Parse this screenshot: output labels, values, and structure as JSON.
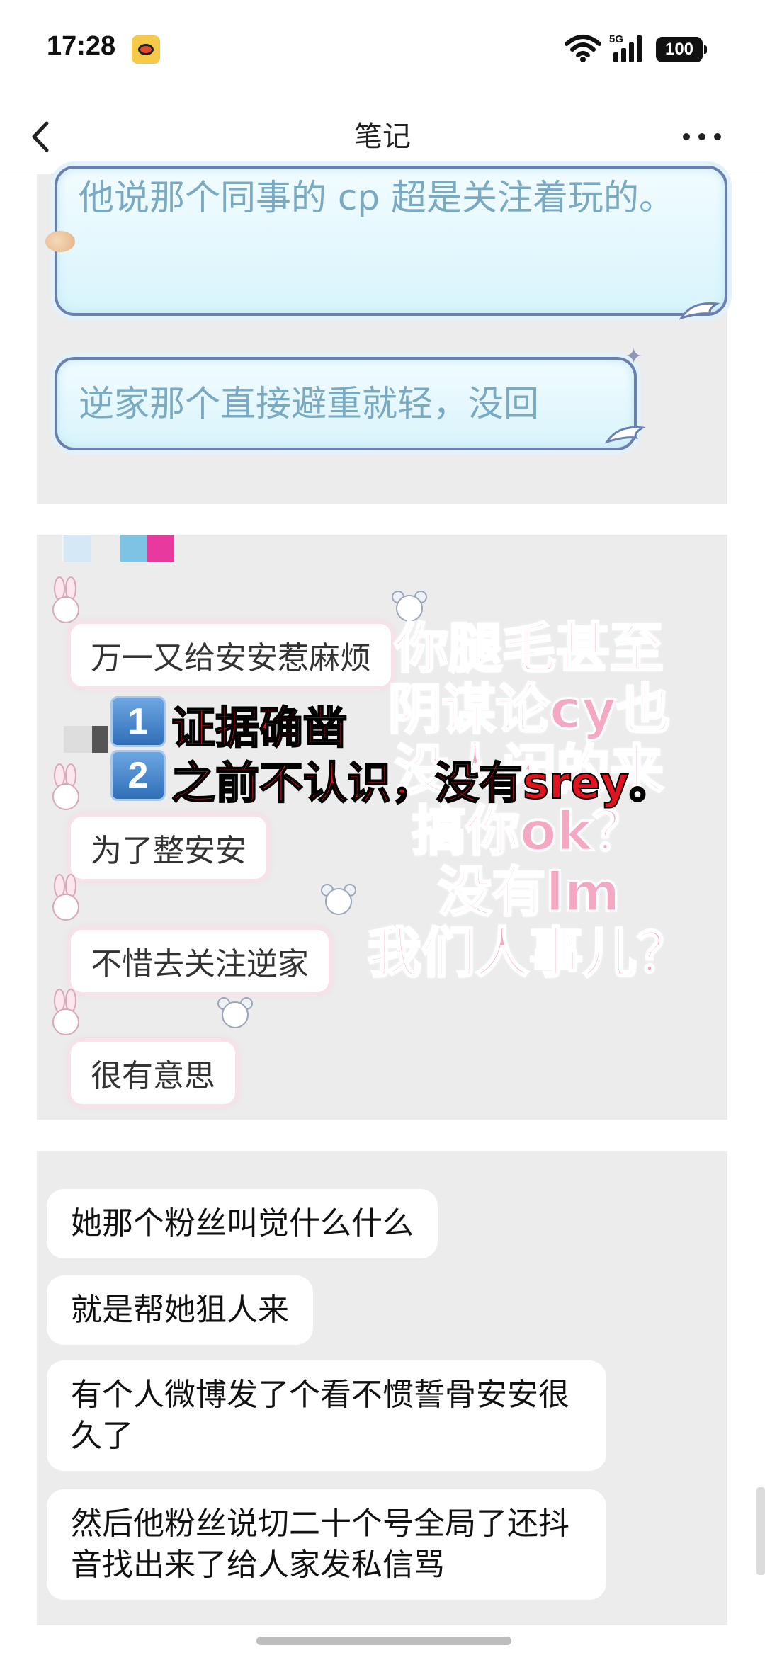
{
  "status_bar": {
    "time": "17:28",
    "network": "5G",
    "battery": "100"
  },
  "nav": {
    "title": "笔记"
  },
  "panel1": {
    "bubble1": "他说那个同事的 cp 超是关注着玩的。",
    "bubble2": "逆家那个直接避重就轻，没回"
  },
  "panel2": {
    "bubbles": [
      "万一又给安安惹麻烦",
      "为了整安安",
      "不惜去关注逆家",
      "很有意思"
    ],
    "badges": [
      "1",
      "2"
    ],
    "red_lines": [
      "证据确凿",
      "之前不认识，没有srey。"
    ],
    "pink_lines": [
      "你腿毛甚至",
      "阴谋论cy也",
      "没人闲的来",
      "搞你ok？",
      "没有lm",
      "我们人事儿？"
    ],
    "swatch_colors": [
      "#d4e8f6",
      "#7ec3e3",
      "#e83a9e"
    ]
  },
  "panel3": {
    "messages": [
      "她那个粉丝叫觉什么什么",
      "就是帮她狙人来",
      "有个人微博发了个看不惯誓骨安安很久了",
      "然后他粉丝说切二十个号全局了还抖音找出来了给人家发私信骂"
    ]
  }
}
